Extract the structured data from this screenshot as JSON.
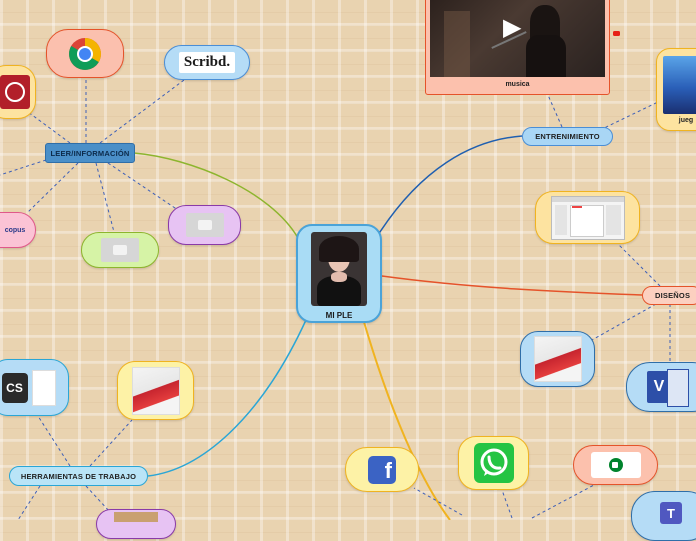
{
  "central": {
    "label": "MI PLE"
  },
  "branches": {
    "leer": "LEER/INFORMACIÓN",
    "entretenimiento": "ENTRENIMIENTO",
    "disenos": "DISEÑOS",
    "herramientas": "HERRAMIENTAS DE TRABAJO"
  },
  "items": {
    "musica": "musica",
    "juegos": "jueg",
    "scopus": "copus",
    "scribd": "Scribd.",
    "play": "▶"
  },
  "colors": {
    "entretenimiento_line": "#1f5fb0",
    "disenos_line": "#e5532a",
    "leer_line": "#8db52e",
    "herramientas_line": "#2aa6d6",
    "social_line": "#f0b320"
  }
}
